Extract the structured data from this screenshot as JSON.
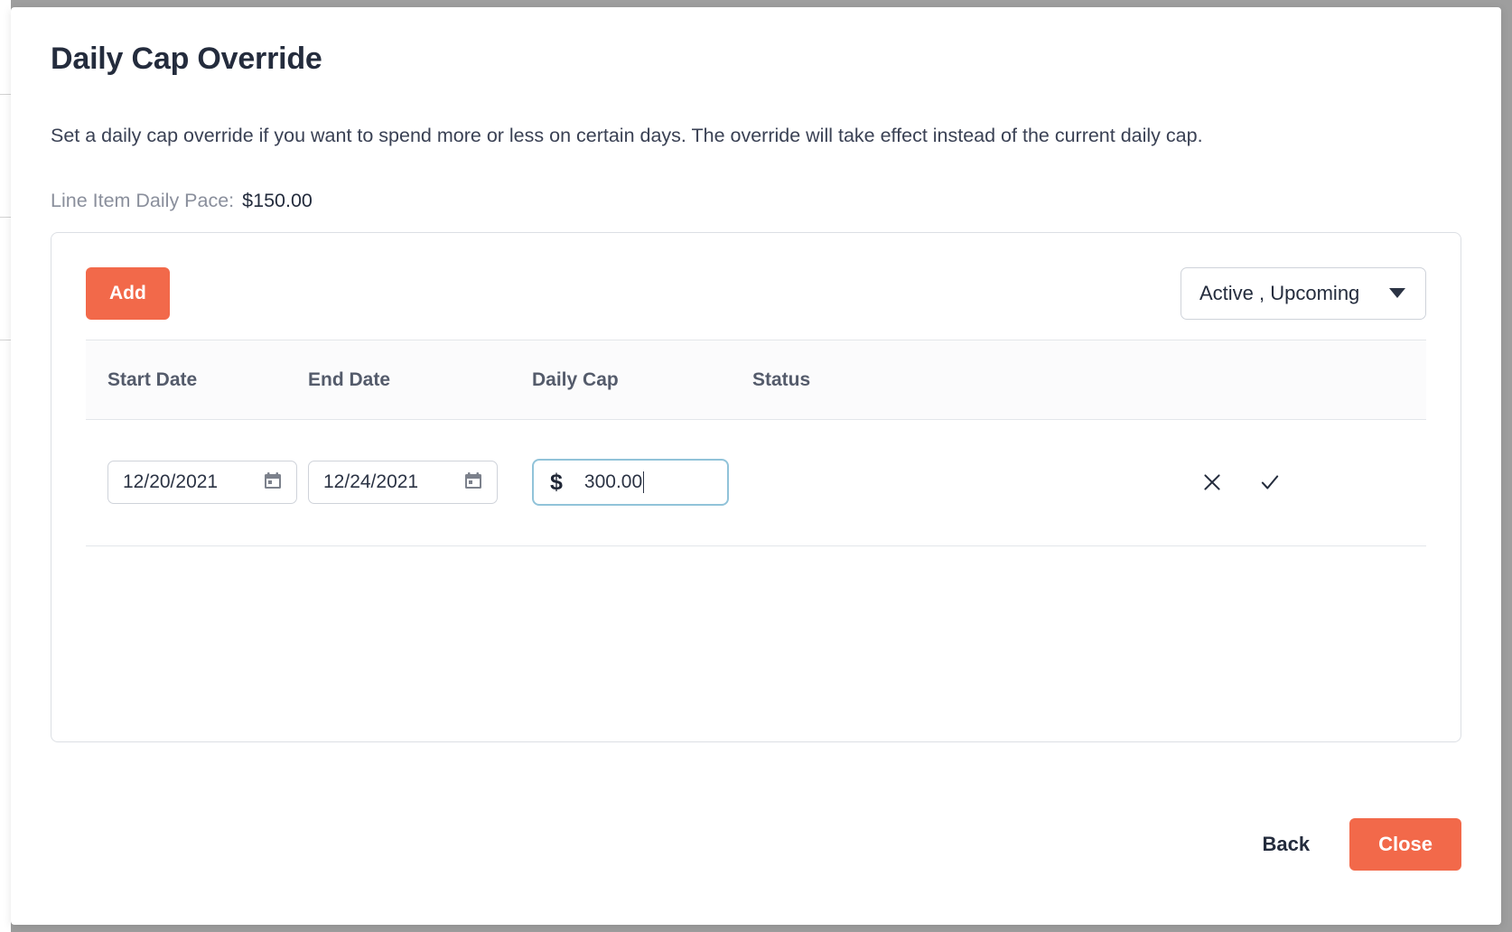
{
  "modal": {
    "title": "Daily Cap Override",
    "description": "Set a daily cap override if you want to spend more or less on certain days. The override will take effect instead of the current daily cap.",
    "pace_label": "Line Item Daily Pace:",
    "pace_value": "$150.00"
  },
  "toolbar": {
    "add_label": "Add",
    "status_filter_value": "Active , Upcoming",
    "caret_icon": "chevron-down-icon"
  },
  "table": {
    "columns": [
      "Start Date",
      "End Date",
      "Daily Cap",
      "Status"
    ],
    "rows": [
      {
        "start_date": "12/20/2021",
        "end_date": "12/24/2021",
        "currency_symbol": "$",
        "daily_cap": "300.00",
        "status": "",
        "cancel_icon": "close-icon",
        "confirm_icon": "check-icon"
      }
    ]
  },
  "footer": {
    "back_label": "Back",
    "close_label": "Close"
  },
  "colors": {
    "accent": "#f2694a",
    "text_dark": "#242c3d",
    "text_muted": "#8a8f9c",
    "focus_border": "#91c3d9",
    "border": "#dcdfe4"
  }
}
